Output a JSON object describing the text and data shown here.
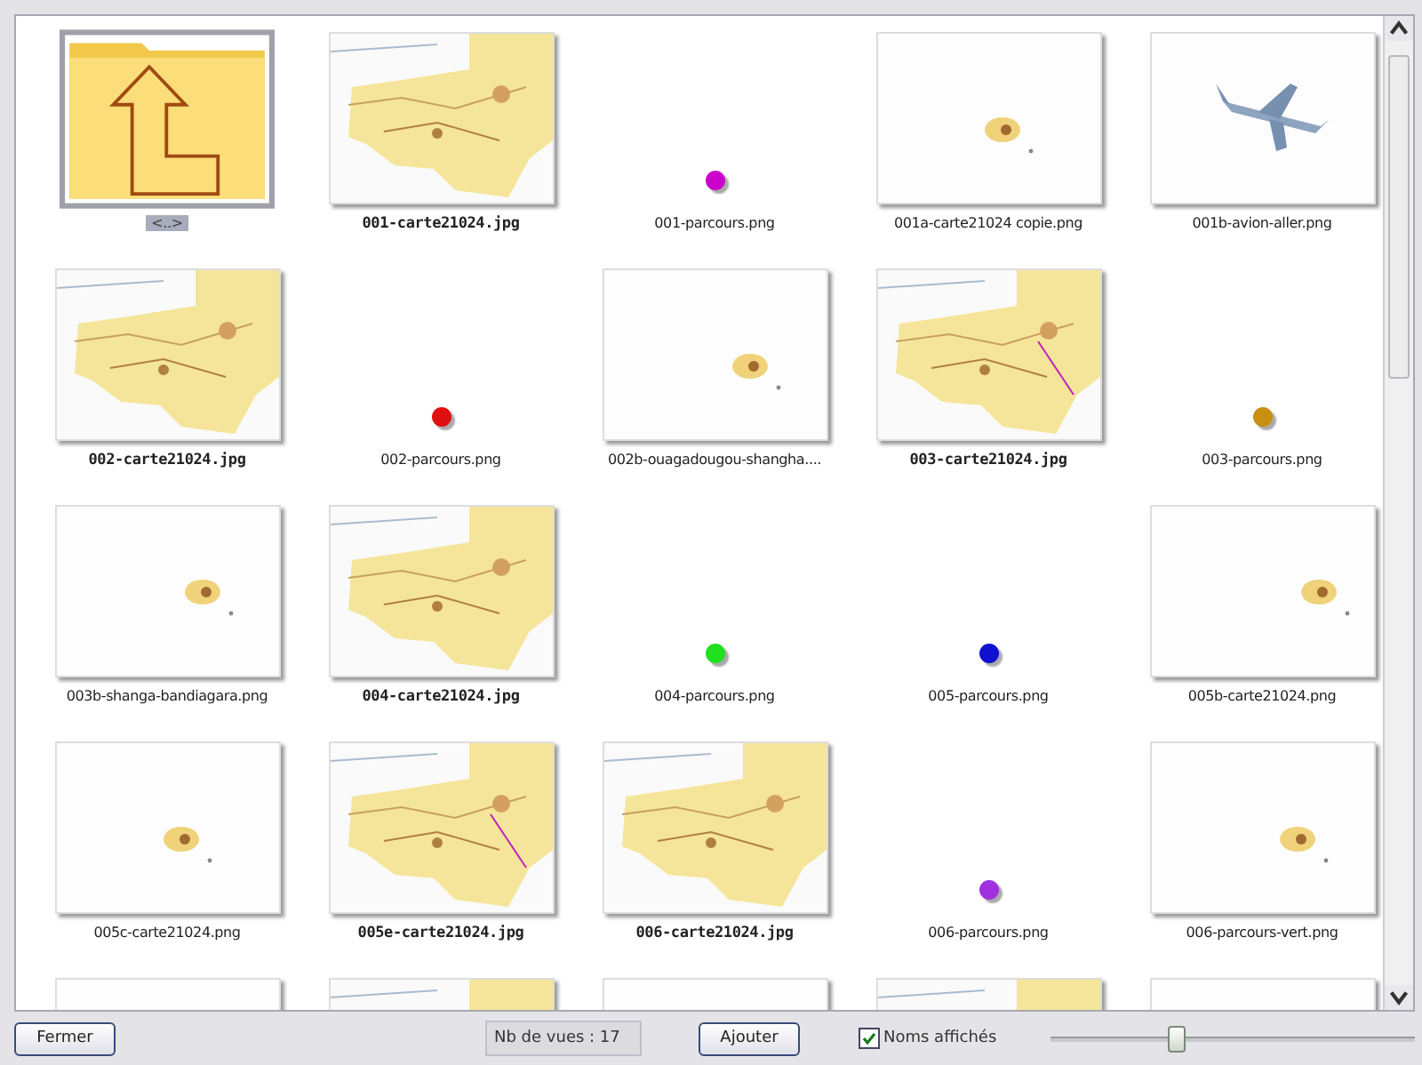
{
  "items": [
    {
      "kind": "folder",
      "label": "<..>",
      "bold": false,
      "selected": true
    },
    {
      "kind": "map",
      "label": "001-carte21024.jpg",
      "bold": true,
      "selected": false
    },
    {
      "kind": "dot",
      "label": "001-parcours.png",
      "bold": false,
      "selected": false,
      "color": "#cc00cc"
    },
    {
      "kind": "sparse",
      "label": "001a-carte21024 copie.png",
      "bold": false,
      "selected": false
    },
    {
      "kind": "plane",
      "label": "001b-avion-aller.png",
      "bold": false,
      "selected": false
    },
    {
      "kind": "map",
      "label": "002-carte21024.jpg",
      "bold": true,
      "selected": false
    },
    {
      "kind": "dot",
      "label": "002-parcours.png",
      "bold": false,
      "selected": false,
      "color": "#e01010"
    },
    {
      "kind": "sparse",
      "label": "002b-ouagadougou-shangha....",
      "bold": false,
      "selected": false
    },
    {
      "kind": "map",
      "label": "003-carte21024.jpg",
      "bold": true,
      "selected": false
    },
    {
      "kind": "dot",
      "label": "003-parcours.png",
      "bold": false,
      "selected": false,
      "color": "#c89010"
    },
    {
      "kind": "sparse",
      "label": "003b-shanga-bandiagara.png",
      "bold": false,
      "selected": false
    },
    {
      "kind": "map",
      "label": "004-carte21024.jpg",
      "bold": true,
      "selected": false
    },
    {
      "kind": "dot",
      "label": "004-parcours.png",
      "bold": false,
      "selected": false,
      "color": "#20e020"
    },
    {
      "kind": "dot",
      "label": "005-parcours.png",
      "bold": false,
      "selected": false,
      "color": "#1010d0"
    },
    {
      "kind": "sparse",
      "label": "005b-carte21024.png",
      "bold": false,
      "selected": false
    },
    {
      "kind": "sparse",
      "label": "005c-carte21024.png",
      "bold": false,
      "selected": false
    },
    {
      "kind": "map",
      "label": "005e-carte21024.jpg",
      "bold": true,
      "selected": false
    },
    {
      "kind": "map",
      "label": "006-carte21024.jpg",
      "bold": true,
      "selected": false
    },
    {
      "kind": "dot",
      "label": "006-parcours.png",
      "bold": false,
      "selected": false,
      "color": "#a030e0"
    },
    {
      "kind": "sparse",
      "label": "006-parcours-vert.png",
      "bold": false,
      "selected": false
    },
    {
      "kind": "sparse"
    },
    {
      "kind": "map"
    },
    {
      "kind": "sparse"
    },
    {
      "kind": "map"
    },
    {
      "kind": "sparse"
    }
  ],
  "buttons": {
    "close": "Fermer",
    "add": "Ajouter"
  },
  "count": "Nb de vues : 17",
  "names_checkbox": {
    "label": "Noms affichés",
    "checked": true
  },
  "zoom_slider": {
    "level": 0.35
  }
}
